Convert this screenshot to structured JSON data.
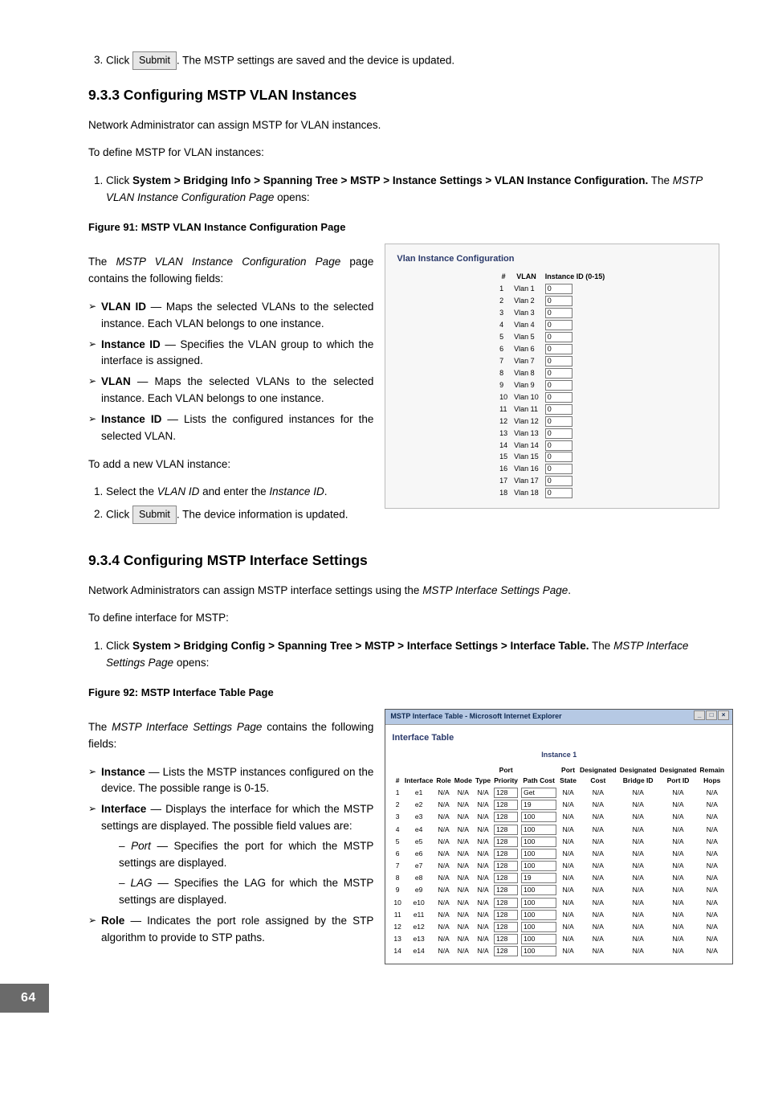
{
  "step3": {
    "num": "3.",
    "pre": "Click",
    "btn": "Submit",
    "post": ". The MSTP settings are saved and the device is updated."
  },
  "s933": {
    "heading": "9.3.3   Configuring MSTP VLAN Instances",
    "p1": "Network Administrator can assign MSTP for VLAN instances.",
    "p2": "To define MSTP for VLAN instances:",
    "step1": {
      "num": "1.",
      "pre": "Click ",
      "path": "System > Bridging Info > Spanning Tree > MSTP > Instance Settings > VLAN Instance Configuration.",
      "post": " The ",
      "ital": "MSTP VLAN Instance Configuration Page",
      "post2": " opens:"
    },
    "figcap": "Figure 91: MSTP VLAN Instance Configuration Page",
    "intro1": "The ",
    "intro_ital": "MSTP VLAN Instance Configuration Page",
    "intro2": " page contains the following fields:",
    "f1": {
      "name": "VLAN ID",
      "desc": " — Maps the selected VLANs to the selected instance. Each VLAN belongs to one instance."
    },
    "f2": {
      "name": "Instance ID",
      "desc": " — Specifies the VLAN group to which the interface is assigned."
    },
    "f3": {
      "name": "VLAN",
      "desc": " — Maps the selected VLANs to the selected instance. Each VLAN belongs to one instance."
    },
    "f4": {
      "name": "Instance ID",
      "desc": " — Lists the configured instances for the selected VLAN."
    },
    "add_intro": "To add a new VLAN instance:",
    "add1": {
      "num": "1.",
      "pre": "Select the ",
      "i1": "VLAN ID",
      "mid": " and enter the ",
      "i2": "Instance ID",
      "end": "."
    },
    "add2": {
      "num": "2.",
      "pre": "Click ",
      "btn": "Submit",
      "post": ". The device information is updated."
    }
  },
  "panel1": {
    "title": "Vlan Instance Configuration",
    "headers": {
      "h1": "#",
      "h2": "VLAN",
      "h3": "Instance ID (0-15)"
    },
    "rows": [
      {
        "n": "1",
        "v": "Vlan 1",
        "id": "0"
      },
      {
        "n": "2",
        "v": "Vlan 2",
        "id": "0"
      },
      {
        "n": "3",
        "v": "Vlan 3",
        "id": "0"
      },
      {
        "n": "4",
        "v": "Vlan 4",
        "id": "0"
      },
      {
        "n": "5",
        "v": "Vlan 5",
        "id": "0"
      },
      {
        "n": "6",
        "v": "Vlan 6",
        "id": "0"
      },
      {
        "n": "7",
        "v": "Vlan 7",
        "id": "0"
      },
      {
        "n": "8",
        "v": "Vlan 8",
        "id": "0"
      },
      {
        "n": "9",
        "v": "Vlan 9",
        "id": "0"
      },
      {
        "n": "10",
        "v": "Vlan 10",
        "id": "0"
      },
      {
        "n": "11",
        "v": "Vlan 11",
        "id": "0"
      },
      {
        "n": "12",
        "v": "Vlan 12",
        "id": "0"
      },
      {
        "n": "13",
        "v": "Vlan 13",
        "id": "0"
      },
      {
        "n": "14",
        "v": "Vlan 14",
        "id": "0"
      },
      {
        "n": "15",
        "v": "Vlan 15",
        "id": "0"
      },
      {
        "n": "16",
        "v": "Vlan 16",
        "id": "0"
      },
      {
        "n": "17",
        "v": "Vlan 17",
        "id": "0"
      },
      {
        "n": "18",
        "v": "Vlan 18",
        "id": "0"
      }
    ]
  },
  "s934": {
    "heading": "9.3.4   Configuring MSTP Interface Settings",
    "p1a": "Network Administrators can assign MSTP interface settings using the ",
    "p1i": "MSTP Interface Settings Page",
    "p1b": ".",
    "p2": "To define interface for MSTP:",
    "step1": {
      "num": "1.",
      "pre": "Click ",
      "path": "System > Bridging Config > Spanning Tree > MSTP > Interface Settings > Interface Table.",
      "post": " The ",
      "ital": "MSTP Interface Settings Page",
      "post2": " opens:"
    },
    "figcap": "Figure 92: MSTP Interface Table Page",
    "intro1": "The ",
    "intro_ital": "MSTP Interface Settings Page",
    "intro2": " contains the following fields:",
    "f1": {
      "name": "Instance",
      "desc": " — Lists the MSTP instances configured on the device. The possible range is 0-15."
    },
    "f2": {
      "name": "Interface",
      "desc": " — Displays the interface for which the MSTP settings are displayed. The possible field values are:"
    },
    "s1": {
      "ital": "Port",
      "desc": " — Specifies the port for which the MSTP settings are displayed."
    },
    "s2": {
      "ital": "LAG",
      "desc": " — Specifies the LAG for which the MSTP settings are displayed."
    },
    "f3": {
      "name": "Role",
      "desc": " — Indicates the port role assigned by the STP algorithm to provide to STP paths."
    }
  },
  "panel2": {
    "wintitle": "MSTP Interface Table - Microsoft Internet Explorer",
    "title": "Interface Table",
    "instlabel": "Instance 1",
    "headers": {
      "h1": "#",
      "h2": "Interface",
      "h3": "Role",
      "h4": "Mode",
      "h5": "Type",
      "h6": "Port Priority",
      "h7": "Path Cost",
      "h8": "Port State",
      "h9": "Designated Cost",
      "h10": "Designated Bridge ID",
      "h11": "Designated Port ID",
      "h12": "Remain Hops"
    },
    "na": "N/A",
    "rows": [
      {
        "n": "1",
        "if": "e1",
        "pp": "128",
        "pc": "Get"
      },
      {
        "n": "2",
        "if": "e2",
        "pp": "128",
        "pc": "19"
      },
      {
        "n": "3",
        "if": "e3",
        "pp": "128",
        "pc": "100"
      },
      {
        "n": "4",
        "if": "e4",
        "pp": "128",
        "pc": "100"
      },
      {
        "n": "5",
        "if": "e5",
        "pp": "128",
        "pc": "100"
      },
      {
        "n": "6",
        "if": "e6",
        "pp": "128",
        "pc": "100"
      },
      {
        "n": "7",
        "if": "e7",
        "pp": "128",
        "pc": "100"
      },
      {
        "n": "8",
        "if": "e8",
        "pp": "128",
        "pc": "19"
      },
      {
        "n": "9",
        "if": "e9",
        "pp": "128",
        "pc": "100"
      },
      {
        "n": "10",
        "if": "e10",
        "pp": "128",
        "pc": "100"
      },
      {
        "n": "11",
        "if": "e11",
        "pp": "128",
        "pc": "100"
      },
      {
        "n": "12",
        "if": "e12",
        "pp": "128",
        "pc": "100"
      },
      {
        "n": "13",
        "if": "e13",
        "pp": "128",
        "pc": "100"
      },
      {
        "n": "14",
        "if": "e14",
        "pp": "128",
        "pc": "100"
      }
    ]
  },
  "pagenum": "64"
}
